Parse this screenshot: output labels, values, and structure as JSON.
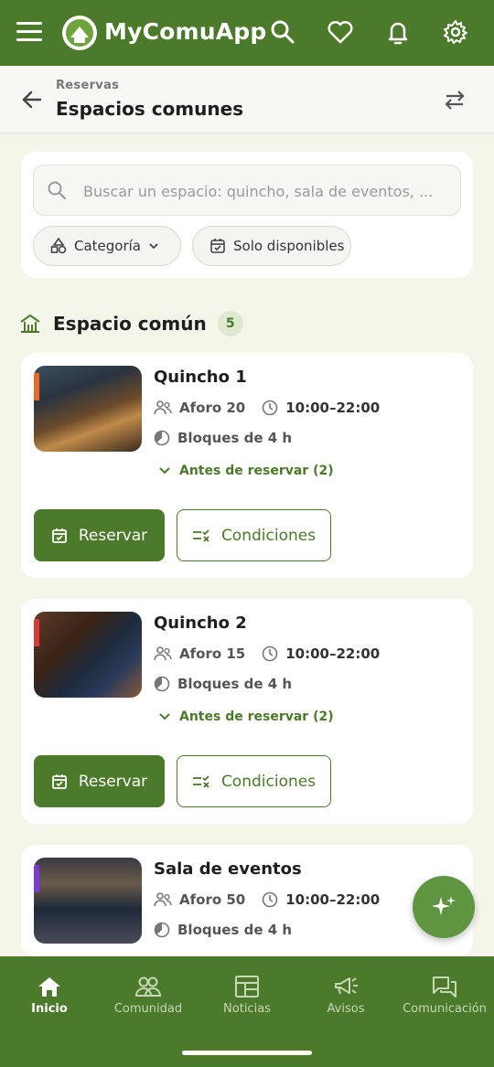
{
  "app": {
    "name": "MyComuApp"
  },
  "header": {
    "breadcrumb": "Reservas",
    "title": "Espacios comunes"
  },
  "search": {
    "placeholder": "Buscar un espacio: quincho, sala de eventos, ..."
  },
  "filters": {
    "category_label": "Categoría",
    "available_label": "Solo disponibles"
  },
  "section": {
    "title": "Espacio común",
    "count": "5"
  },
  "spaces": [
    {
      "name": "Quincho 1",
      "capacity": "Aforo 20",
      "hours": "10:00–22:00",
      "blocks": "Bloques de 4 h",
      "before": "Antes de reservar (2)",
      "reserve": "Reservar",
      "conditions": "Condiciones",
      "accent": "#e86a2a"
    },
    {
      "name": "Quincho 2",
      "capacity": "Aforo 15",
      "hours": "10:00–22:00",
      "blocks": "Bloques de 4 h",
      "before": "Antes de reservar (2)",
      "reserve": "Reservar",
      "conditions": "Condiciones",
      "accent": "#d83a3a"
    },
    {
      "name": "Sala de eventos",
      "capacity": "Aforo 50",
      "hours": "10:00–22:00",
      "blocks": "Bloques de 4 h",
      "accent": "#7a3ad8"
    }
  ],
  "nav": [
    {
      "label": "Inicio",
      "icon": "home-icon",
      "active": true
    },
    {
      "label": "Comunidad",
      "icon": "community-icon"
    },
    {
      "label": "Noticias",
      "icon": "news-icon"
    },
    {
      "label": "Avisos",
      "icon": "megaphone-icon"
    },
    {
      "label": "Comunicación",
      "icon": "chat-icon"
    }
  ],
  "colors": {
    "primary": "#4a7a2a",
    "background": "#f4f6ea",
    "badge": "#dfe9cf"
  }
}
